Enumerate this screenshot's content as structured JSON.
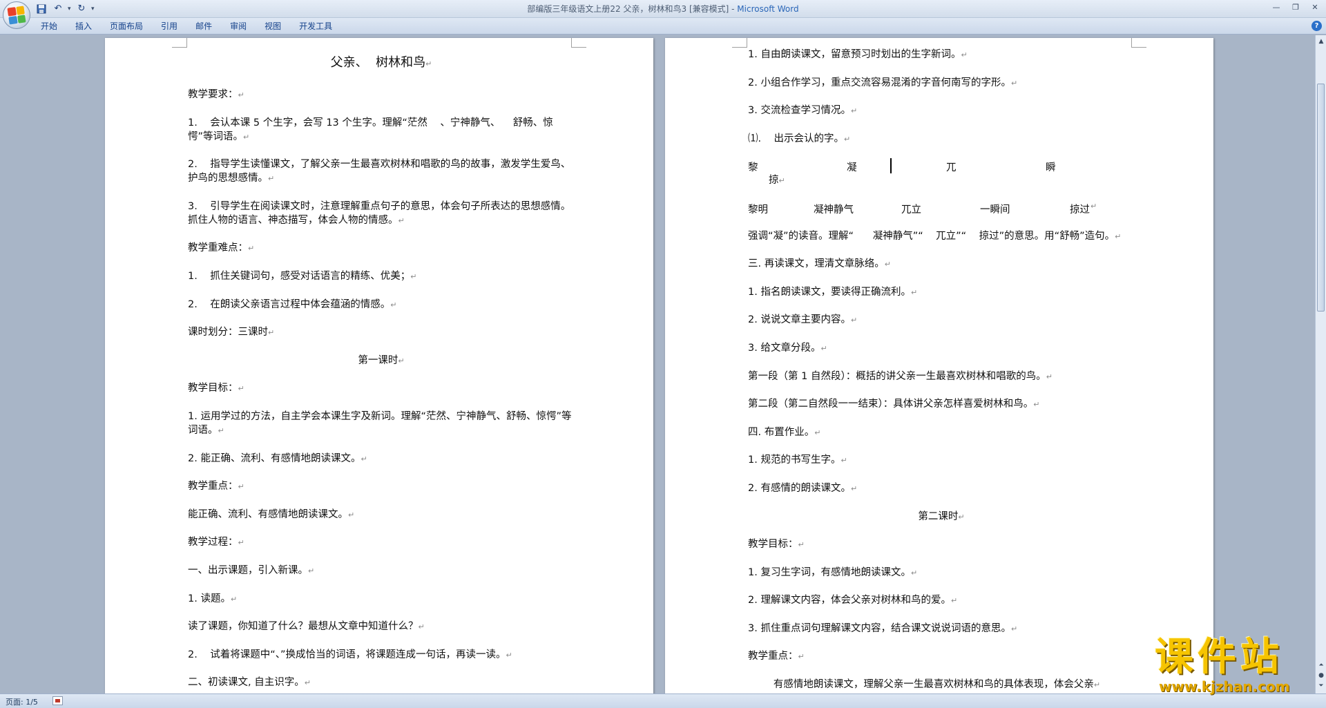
{
  "window": {
    "title_doc": "部编版三年级语文上册22 父亲，树林和鸟3 [兼容模式]",
    "title_sep": " - ",
    "title_app": "Microsoft Word"
  },
  "ribbon": {
    "tabs": [
      "开始",
      "插入",
      "页面布局",
      "引用",
      "邮件",
      "审阅",
      "视图",
      "开发工具"
    ]
  },
  "left_page": {
    "title": "父亲、  树林和鸟",
    "paragraphs": [
      "教学要求：",
      "1.    会认本课 5 个生字，会写 13 个生字。理解“茫然    、宁神静气、    舒畅、惊愕”等词语。",
      "2.    指导学生读懂课文，了解父亲一生最喜欢树林和唱歌的鸟的故事，激发学生爱鸟、    护鸟的思想感情。",
      "3.    引导学生在阅读课文时，注意理解重点句子的意思，体会句子所表达的思想感情。抓住人物的语言、神态描写，体会人物的情感。",
      "教学重难点：",
      "1.    抓住关键词句，感受对话语言的精练、优美；",
      "2.    在朗读父亲语言过程中体会蕴涵的情感。",
      "课时划分：三课时",
      "第一课时",
      "教学目标：",
      "1. 运用学过的方法，自主学会本课生字及新词。理解“茫然、宁神静气、舒畅、惊愕”等词语。",
      "2. 能正确、流利、有感情地朗读课文。",
      "教学重点：",
      "能正确、流利、有感情地朗读课文。",
      "教学过程：",
      "一、出示课题，引入新课。",
      "1. 读题。",
      "读了课题，你知道了什么？最想从文章中知道什么？",
      "2.    试着将课题中“、”换成恰当的词语，将课题连成一句话，再读一读。",
      "二、初读课文, 自主识字。"
    ]
  },
  "right_page": {
    "paragraphs_a": [
      "1. 自由朗读课文，留意预习时划出的生字新词。",
      "2. 小组合作学习，重点交流容易混淆的字音何南写的字形。",
      "3. 交流检查学习情况。",
      "⑴.    出示会认的字。"
    ],
    "chars": [
      "黎",
      "凝",
      "兀",
      "瞬"
    ],
    "chars_wrap": "掠",
    "words": [
      "黎明",
      "凝神静气",
      "兀立",
      "一瞬间",
      "掠过"
    ],
    "paragraphs_b": [
      "强调“凝”的读音。理解“      凝神静气”“    兀立”“    掠过”的意思。用“舒畅”造句。",
      "三. 再读课文，理清文章脉络。",
      "1. 指名朗读课文，要读得正确流利。",
      "2. 说说文章主要内容。",
      "3. 给文章分段。",
      "第一段（第 1 自然段）：概括的讲父亲一生最喜欢树林和唱歌的鸟。",
      "第二段（第二自然段一一结束）：具体讲父亲怎样喜爱树林和鸟。",
      "四. 布置作业。",
      "1. 规范的书写生字。",
      "2. 有感情的朗读课文。",
      "第二课时",
      "教学目标：",
      "1. 复习生字词，有感情地朗读课文。",
      "2. 理解课文内容，体会父亲对树林和鸟的爱。",
      "3. 抓住重点词句理解课文内容，结合课文说说词语的意思。",
      "教学重点：",
      "        有感情地朗读课文，理解父亲一生最喜欢树林和鸟的具体表现，体会父亲"
    ]
  },
  "status": {
    "page": "页面: 1/5"
  },
  "watermark": {
    "main": "课件站",
    "url": "www.kjzhan.com"
  },
  "colors": {
    "office_logo": [
      "#e8412a",
      "#f7b500",
      "#3a8fd6",
      "#4fb848"
    ]
  }
}
